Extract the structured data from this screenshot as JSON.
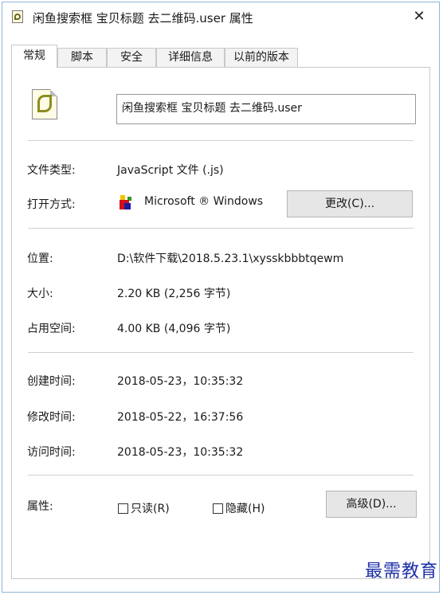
{
  "window": {
    "title": "闲鱼搜索框 宝贝标题 去二维码.user 属性",
    "close": "✕"
  },
  "tabs": [
    {
      "label": "常规",
      "active": true
    },
    {
      "label": "脚本"
    },
    {
      "label": "安全"
    },
    {
      "label": "详细信息"
    },
    {
      "label": "以前的版本"
    }
  ],
  "file": {
    "name": "闲鱼搜索框 宝贝标题 去二维码.user",
    "icon": "script-file-icon"
  },
  "info": {
    "type": {
      "label": "文件类型:",
      "value": "JavaScript 文件 (.js)"
    },
    "opens_with": {
      "label": "打开方式:",
      "value": "Microsoft ® Windows",
      "button": "更改(C)..."
    },
    "location": {
      "label": "位置:",
      "value": "D:\\软件下载\\2018.5.23.1\\xysskbbbtqewm"
    },
    "size": {
      "label": "大小:",
      "value": "2.20 KB (2,256 字节)"
    },
    "size_on_disk": {
      "label": "占用空间:",
      "value": "4.00 KB (4,096 字节)"
    },
    "created": {
      "label": "创建时间:",
      "value": "2018-05-23，10:35:32"
    },
    "modified": {
      "label": "修改时间:",
      "value": "2018-05-22，16:37:56"
    },
    "accessed": {
      "label": "访问时间:",
      "value": "2018-05-23，10:35:32"
    }
  },
  "attributes": {
    "label": "属性:",
    "readonly": {
      "label": "只读(R)",
      "checked": false
    },
    "hidden": {
      "label": "隐藏(H)",
      "checked": false
    },
    "advanced_button": "高级(D)..."
  },
  "watermark": "最需教育"
}
